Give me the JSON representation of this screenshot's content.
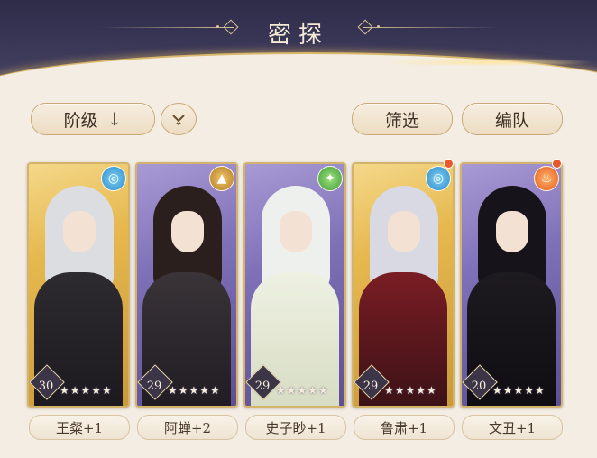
{
  "header": {
    "title": "密探"
  },
  "toolbar": {
    "sort_label": "阶级",
    "sort_arrow": "↓",
    "filter_label": "筛选",
    "team_label": "编队"
  },
  "cards": [
    {
      "name": "王粲+1",
      "level": "30",
      "element": "water-icon",
      "glyph": "◎",
      "stars": "★★★★★",
      "frame": "gold"
    },
    {
      "name": "阿蝉+2",
      "level": "29",
      "element": "earth-icon",
      "glyph": "▲",
      "stars": "★★★★★",
      "frame": "purple"
    },
    {
      "name": "史子眇+1",
      "level": "29",
      "element": "wood-icon",
      "glyph": "✦",
      "stars": "★★★★★",
      "frame": "purple"
    },
    {
      "name": "鲁肃+1",
      "level": "29",
      "element": "water-icon",
      "glyph": "◎",
      "stars": "★★★★★",
      "frame": "gold"
    },
    {
      "name": "文丑+1",
      "level": "20",
      "element": "fire-icon",
      "glyph": "♨",
      "stars": "★★★★★",
      "frame": "purple"
    }
  ]
}
